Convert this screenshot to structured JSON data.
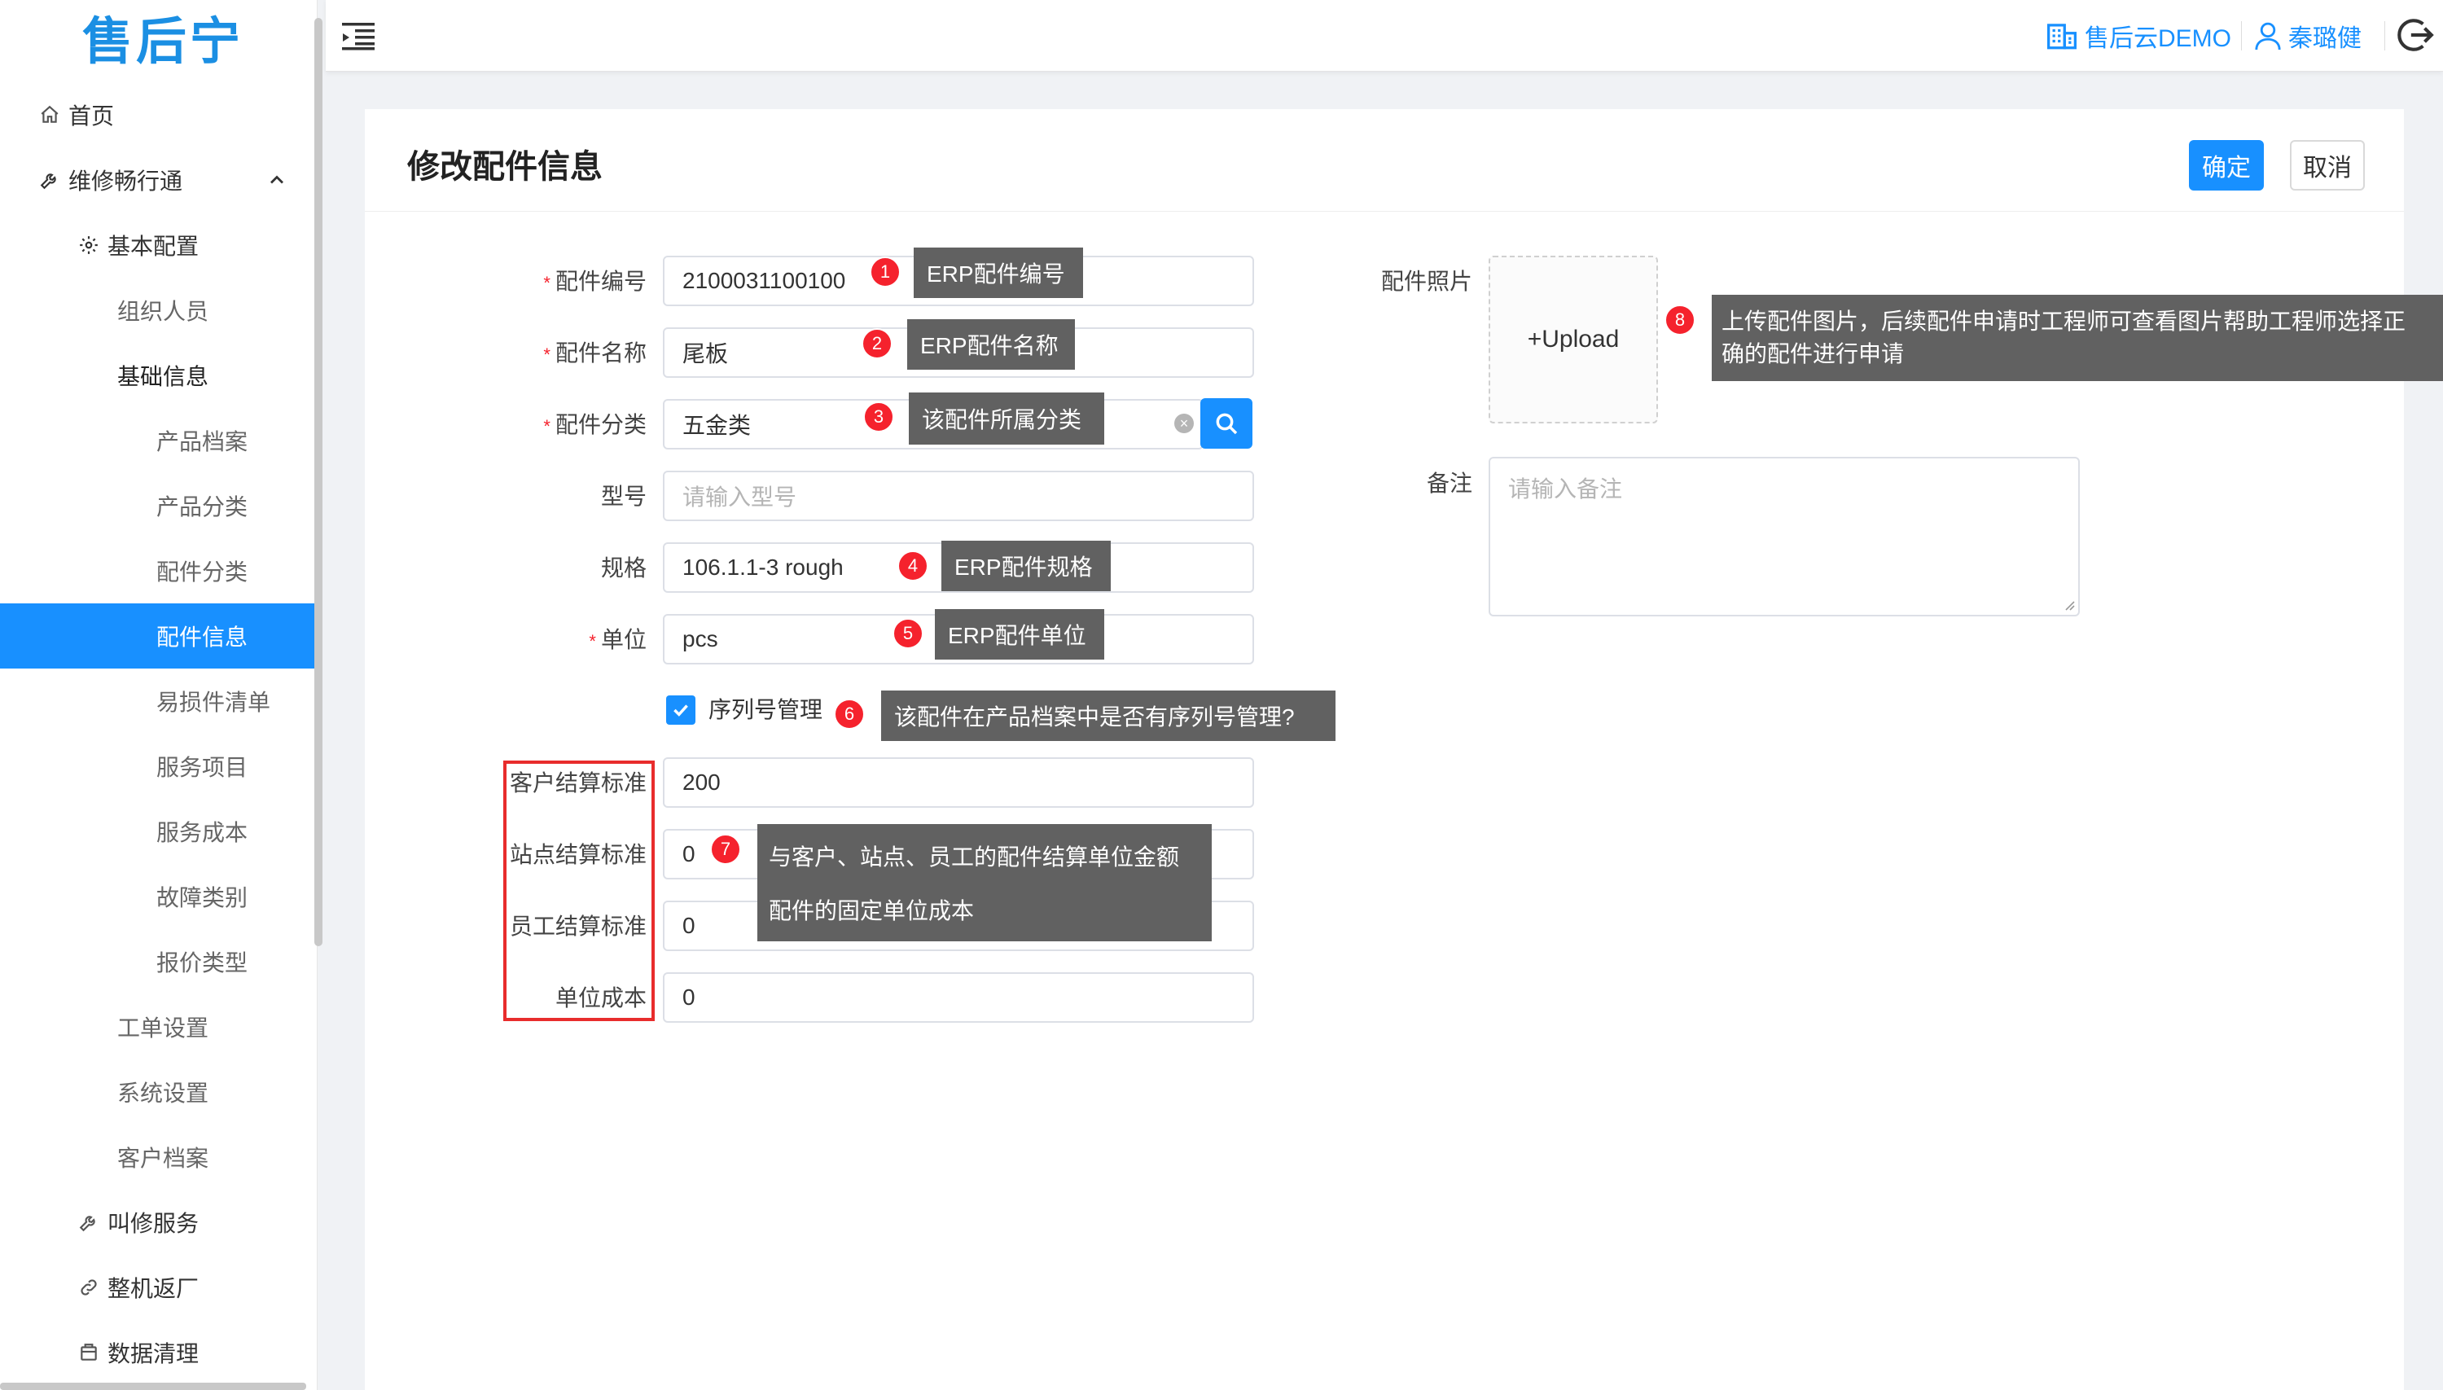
{
  "app": {
    "logo_text": "售后宁"
  },
  "sidebar": {
    "items": [
      {
        "label": "首页",
        "icon": "home-icon"
      },
      {
        "label": "维修畅行通",
        "icon": "wrench-icon"
      },
      {
        "label": "基本配置",
        "icon": "gear-icon"
      },
      {
        "label": "组织人员"
      },
      {
        "label": "基础信息"
      },
      {
        "label": "产品档案"
      },
      {
        "label": "产品分类"
      },
      {
        "label": "配件分类"
      },
      {
        "label": "配件信息",
        "active": true
      },
      {
        "label": "易损件清单"
      },
      {
        "label": "服务项目"
      },
      {
        "label": "服务成本"
      },
      {
        "label": "故障类别"
      },
      {
        "label": "报价类型"
      },
      {
        "label": "工单设置"
      },
      {
        "label": "系统设置"
      },
      {
        "label": "客户档案"
      },
      {
        "label": "叫修服务",
        "icon": "wrench-icon"
      },
      {
        "label": "整机返厂",
        "icon": "link-icon"
      },
      {
        "label": "数据清理",
        "icon": "database-icon"
      }
    ]
  },
  "header": {
    "org": "售后云DEMO",
    "user": "秦璐健"
  },
  "page": {
    "title": "修改配件信息",
    "ok_label": "确定",
    "cancel_label": "取消"
  },
  "form": {
    "code": {
      "label": "配件编号",
      "value": "2100031100100"
    },
    "name": {
      "label": "配件名称",
      "value": "尾板"
    },
    "category": {
      "label": "配件分类",
      "value": "五金类"
    },
    "model": {
      "label": "型号",
      "placeholder": "请输入型号"
    },
    "spec": {
      "label": "规格",
      "value": "106.1.1-3 rough"
    },
    "unit": {
      "label": "单位",
      "value": "pcs"
    },
    "serial": {
      "label": "序列号管理",
      "checked": true
    },
    "customer_std": {
      "label": "客户结算标准",
      "value": "200"
    },
    "site_std": {
      "label": "站点结算标准",
      "value": "0"
    },
    "staff_std": {
      "label": "员工结算标准",
      "value": "0"
    },
    "unit_cost": {
      "label": "单位成本",
      "value": "0"
    },
    "photo": {
      "label": "配件照片",
      "upload_label": "+Upload"
    },
    "remark": {
      "label": "备注",
      "placeholder": "请输入备注"
    }
  },
  "tips": {
    "t1": {
      "num": "1",
      "text": "ERP配件编号"
    },
    "t2": {
      "num": "2",
      "text": "ERP配件名称"
    },
    "t3": {
      "num": "3",
      "text": "该配件所属分类"
    },
    "t4": {
      "num": "4",
      "text": "ERP配件规格"
    },
    "t5": {
      "num": "5",
      "text": "ERP配件单位"
    },
    "t6": {
      "num": "6",
      "text": "该配件在产品档案中是否有序列号管理?"
    },
    "t7": {
      "num": "7",
      "line1": "与客户、站点、员工的配件结算单位金额",
      "line2": "配件的固定单位成本"
    },
    "t8": {
      "num": "8",
      "line1": "上传配件图片，后续配件申请时工程师可查看图片帮助工程师选择正",
      "line2": "确的配件进行申请"
    }
  },
  "colors": {
    "primary": "#1890ff",
    "badge": "#f5222d",
    "tip_bg": "#616161",
    "highlight_box": "#e82c2c"
  }
}
